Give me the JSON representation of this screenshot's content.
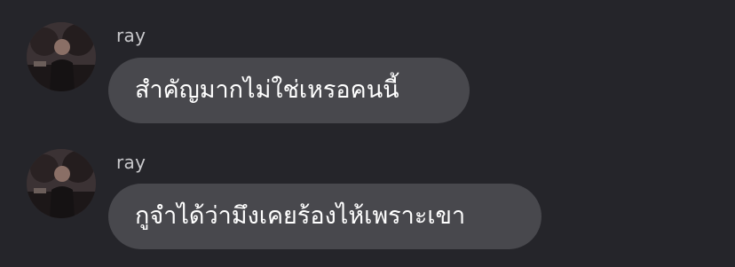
{
  "conversation": {
    "messages": [
      {
        "sender": "ray",
        "avatar_icon": "user-photo-avatar",
        "text": "สำคัญมากไม่ใช่เหรอคนนี้"
      },
      {
        "sender": "ray",
        "avatar_icon": "user-photo-avatar",
        "text": "กูจำได้ว่ามึงเคยร้องไห้เพราะเขา"
      }
    ]
  },
  "colors": {
    "background": "#25252a",
    "bubble": "#48484d",
    "message_text": "#ffffff",
    "sender_text": "#c9c9cc"
  }
}
